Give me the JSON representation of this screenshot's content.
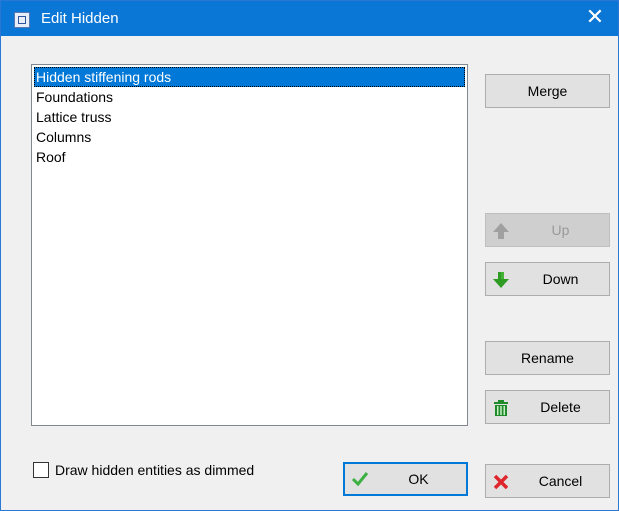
{
  "window": {
    "title": "Edit Hidden",
    "close_label": "✕"
  },
  "list": {
    "items": [
      {
        "label": "Hidden stiffening rods",
        "selected": true
      },
      {
        "label": "Foundations",
        "selected": false
      },
      {
        "label": "Lattice truss",
        "selected": false
      },
      {
        "label": "Columns",
        "selected": false
      },
      {
        "label": "Roof",
        "selected": false
      }
    ]
  },
  "buttons": {
    "merge": "Merge",
    "up": "Up",
    "down": "Down",
    "rename": "Rename",
    "delete": "Delete",
    "ok": "OK",
    "cancel": "Cancel"
  },
  "options": {
    "dim_label": "Draw hidden entities as dimmed",
    "dim_checked": false
  },
  "icons": {
    "up": "arrow-up-icon",
    "down": "arrow-down-icon",
    "delete": "trash-icon",
    "ok": "checkmark-icon",
    "cancel": "x-icon"
  },
  "colors": {
    "titlebar": "#0a76d5",
    "selection": "#0078d7",
    "up_arrow_disabled": "#a0a0a0",
    "down_arrow": "#2e9c23",
    "delete": "#1e8a2a",
    "ok_check": "#3cb043",
    "cancel_x": "#e0262d"
  }
}
